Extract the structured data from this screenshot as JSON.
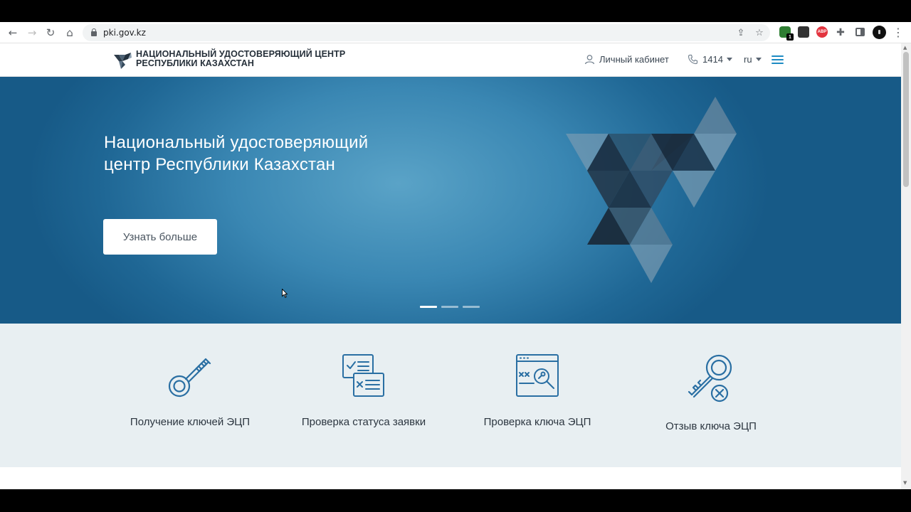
{
  "browser": {
    "url": "pki.gov.kz",
    "extension_badge": "1",
    "abp_label": "ABP"
  },
  "header": {
    "brand_line1": "НАЦИОНАЛЬНЫЙ УДОСТОВЕРЯЮЩИЙ ЦЕНТР",
    "brand_line2": "РЕСПУБЛИКИ КАЗАХСТАН",
    "cabinet_label": "Личный кабинет",
    "phone_label": "1414",
    "language_label": "ru"
  },
  "hero": {
    "title_line1": "Национальный удостоверяющий",
    "title_line2": "центр Республики Казахстан",
    "button_label": "Узнать больше",
    "slides": 3,
    "active_slide": 1
  },
  "services": [
    {
      "label": "Получение ключей ЭЦП",
      "icon": "key-icon"
    },
    {
      "label": "Проверка статуса заявки",
      "icon": "documents-check-icon"
    },
    {
      "label": "Проверка ключа ЭЦП",
      "icon": "key-search-icon"
    },
    {
      "label": "Отзыв ключа ЭЦП",
      "icon": "key-revoke-icon"
    }
  ],
  "colors": {
    "accent": "#1e8bc3",
    "hero_blue": "#3a87b3",
    "icon_blue": "#2a6fa3",
    "services_bg": "#e8eff2"
  }
}
